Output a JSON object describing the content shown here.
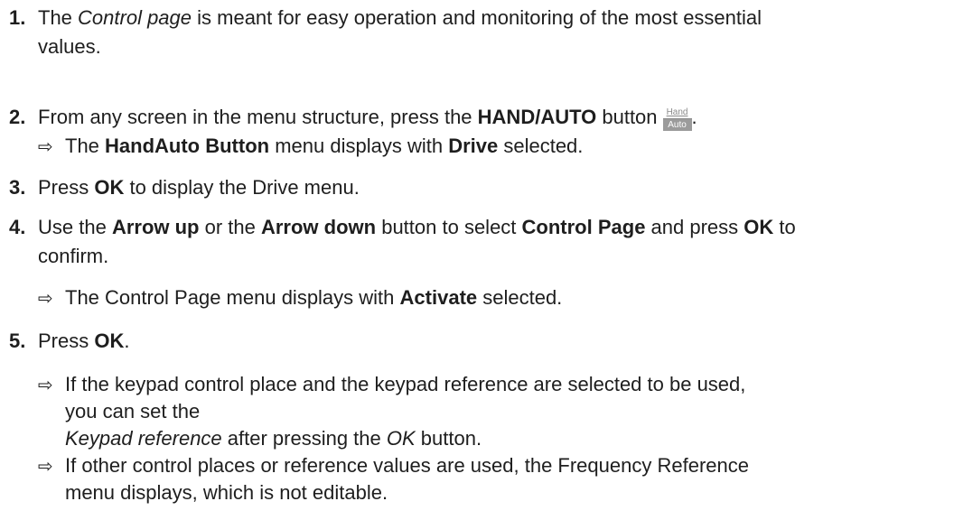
{
  "steps": [
    {
      "number": "1.",
      "line1": {
        "t1": "The ",
        "em": "Control page",
        "t2": " is meant for easy operation and monitoring of the most essential"
      },
      "line2": "values."
    },
    {
      "number": "2.",
      "t1": "From any screen in the menu structure, press the ",
      "bold": "HAND/AUTO",
      "t2": " button",
      "t3": ".",
      "icon": {
        "name": "hand-auto-button-icon",
        "top_label": "Hand",
        "bottom_label": "Auto"
      },
      "result": {
        "t1": "The ",
        "b1": "HandAuto Button",
        "t2": " menu displays with ",
        "b2": "Drive",
        "t3": " selected."
      }
    },
    {
      "number": "3.",
      "t1": "Press ",
      "b1": "OK",
      "t2": " to display the Drive menu."
    },
    {
      "number": "4.",
      "line1": {
        "t1": "Use the ",
        "b1": "Arrow up",
        "t2": " or the ",
        "b2": "Arrow down",
        "t3": " button to select ",
        "b3": "Control Page",
        "t4": " and press ",
        "b4": "OK",
        "t5": " to"
      },
      "line2": "confirm.",
      "result": {
        "t1": "The Control Page menu displays with ",
        "b1": "Activate",
        "t2": " selected."
      }
    },
    {
      "number": "5.",
      "t1": "Press ",
      "b1": "OK",
      "t2": ".",
      "results": [
        {
          "line1": "If the keypad control place and the keypad reference are selected to be used,",
          "line2": "you can set the",
          "line3": {
            "em1": "Keypad reference",
            "t1": " after pressing the ",
            "em2": "OK",
            "t2": " button."
          }
        },
        {
          "line1": "If other control places or reference values are used, the Frequency Reference",
          "line2": "menu displays, which is not editable."
        }
      ]
    }
  ],
  "result_arrow": "⇨"
}
